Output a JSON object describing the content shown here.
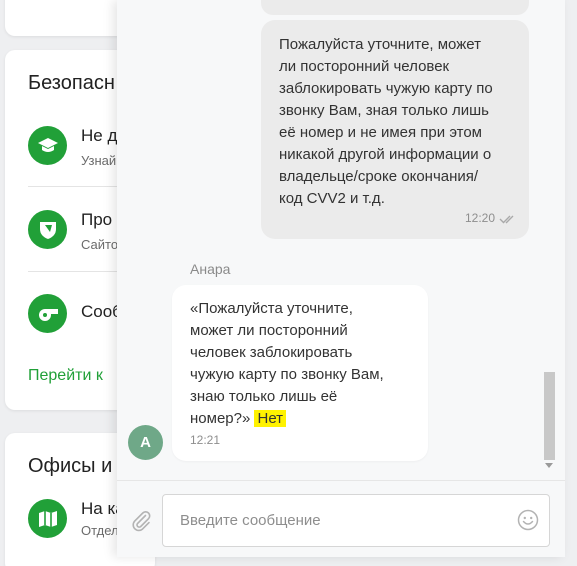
{
  "background": {
    "security_card": {
      "title": "Безопасн",
      "items": [
        {
          "title": "Не д",
          "subtitle": "Узнай",
          "icon": "graduation-cap-icon"
        },
        {
          "title": "Про",
          "subtitle": "Сайто",
          "icon": "shield-icon"
        },
        {
          "title": "Сооб",
          "subtitle": "",
          "icon": "whistle-icon"
        }
      ],
      "link": "Перейти к"
    },
    "offices_card": {
      "title": "Офисы и",
      "item": {
        "title": "На ка",
        "subtitle": "Отдел",
        "icon": "map-icon"
      }
    }
  },
  "chat": {
    "outgoing_message": {
      "text": "Пожалуйста уточните, может\nли посторонний человек\nзаблокировать чужую карту по\nзвонку Вам, зная только лишь\nеё номер и не имея при этом\nникакой другой информации о\nвладельце/сроке окончания/\nкод CVV2 и т.д.",
      "time": "12:20",
      "status_icon": "double-check-icon"
    },
    "incoming_message": {
      "sender_name": "Анара",
      "avatar_letter": "А",
      "quote_text": "«Пожалуйста уточните,\nможет ли посторонний\nчеловек заблокировать\nчужую карту по звонку Вам,\nзнаю только лишь её\nномер?» ",
      "answer_text": "Нет",
      "time": "12:21"
    },
    "composer": {
      "placeholder": "Введите сообщение",
      "value": ""
    }
  },
  "colors": {
    "accent_green": "#21a038",
    "highlight": "#fff200",
    "avatar": "#6fa888"
  }
}
